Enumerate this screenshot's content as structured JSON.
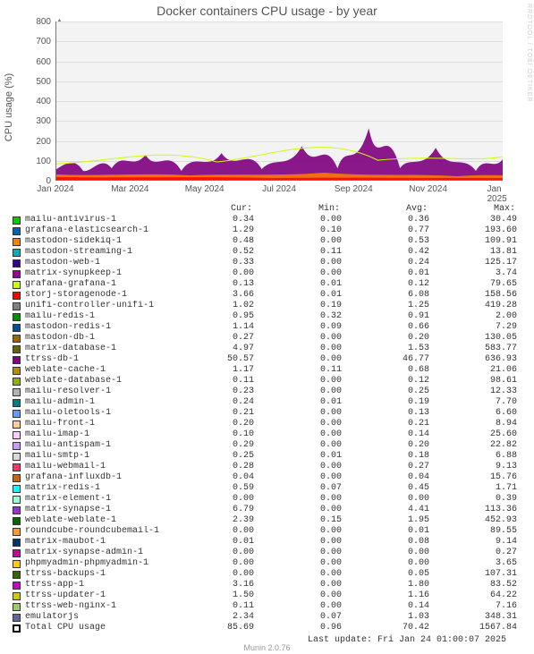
{
  "title": "Docker containers CPU usage - by year",
  "y_axis_label": "CPU usage (%)",
  "watermark": "RRDTOOL / TOBI OETIKER",
  "footer": "Munin 2.0.76",
  "last_update": "Last update: Fri Jan 24 01:00:07 2025",
  "columns": {
    "cur": "Cur:",
    "min": "Min:",
    "avg": "Avg:",
    "max": "Max:"
  },
  "xticks": [
    "Jan 2024",
    "Mar 2024",
    "May 2024",
    "Jul 2024",
    "Sep 2024",
    "Nov 2024",
    "Jan 2025"
  ],
  "yticks": [
    "0",
    "100",
    "200",
    "300",
    "400",
    "500",
    "600",
    "700",
    "800"
  ],
  "chart_baseline_approx": "Stacked area oscillating mostly between ~30 and ~120 with spikes to ~200 around Sep 2024; dominant purple (ttrss-db-1 / matrix / mastodon)",
  "chart_data": {
    "type": "area-stacked",
    "xlabel": "",
    "ylabel": "CPU usage (%)",
    "ylim": [
      0,
      800
    ],
    "x_range": [
      "2024-01",
      "2025-01"
    ],
    "note": "Per-series time points not labeled on chart; values below are legend stats (Cur/Min/Avg/Max). Visual stacked total hovers ~30–120%, occasional spikes ~200% near Sep 2024.",
    "series_stats_ref": "rows"
  },
  "rows": [
    {
      "c": "#00cc00",
      "n": "mailu-antivirus-1",
      "cur": "0.34",
      "min": "0.00",
      "avg": "0.36",
      "max": "30.49"
    },
    {
      "c": "#0066b3",
      "n": "grafana-elasticsearch-1",
      "cur": "1.29",
      "min": "0.10",
      "avg": "0.77",
      "max": "193.60"
    },
    {
      "c": "#ff8000",
      "n": "mastodon-sidekiq-1",
      "cur": "0.48",
      "min": "0.00",
      "avg": "0.53",
      "max": "109.91"
    },
    {
      "c": "#00b3b3",
      "n": "mastodon-streaming-1",
      "cur": "0.52",
      "min": "0.11",
      "avg": "0.42",
      "max": "13.81"
    },
    {
      "c": "#330099",
      "n": "mastodon-web-1",
      "cur": "0.33",
      "min": "0.00",
      "avg": "0.24",
      "max": "125.17"
    },
    {
      "c": "#990099",
      "n": "matrix-synupkeep-1",
      "cur": "0.00",
      "min": "0.00",
      "avg": "0.01",
      "max": "3.74"
    },
    {
      "c": "#ccff00",
      "n": "grafana-grafana-1",
      "cur": "0.13",
      "min": "0.01",
      "avg": "0.12",
      "max": "79.65"
    },
    {
      "c": "#ff0000",
      "n": "storj-storagenode-1",
      "cur": "3.66",
      "min": "0.01",
      "avg": "6.08",
      "max": "158.56"
    },
    {
      "c": "#808080",
      "n": "unifi-controller-unifi-1",
      "cur": "1.02",
      "min": "0.19",
      "avg": "1.25",
      "max": "419.28"
    },
    {
      "c": "#008f00",
      "n": "mailu-redis-1",
      "cur": "0.95",
      "min": "0.32",
      "avg": "0.91",
      "max": "2.00"
    },
    {
      "c": "#004d99",
      "n": "mastodon-redis-1",
      "cur": "1.14",
      "min": "0.09",
      "avg": "0.66",
      "max": "7.29"
    },
    {
      "c": "#996600",
      "n": "mastodon-db-1",
      "cur": "0.27",
      "min": "0.00",
      "avg": "0.20",
      "max": "130.05"
    },
    {
      "c": "#666600",
      "n": "matrix-database-1",
      "cur": "4.97",
      "min": "0.00",
      "avg": "1.53",
      "max": "583.77"
    },
    {
      "c": "#800080",
      "n": "ttrss-db-1",
      "cur": "50.57",
      "min": "0.00",
      "avg": "46.77",
      "max": "636.93"
    },
    {
      "c": "#b38f00",
      "n": "weblate-cache-1",
      "cur": "1.17",
      "min": "0.11",
      "avg": "0.68",
      "max": "21.06"
    },
    {
      "c": "#8fb300",
      "n": "weblate-database-1",
      "cur": "0.11",
      "min": "0.00",
      "avg": "0.12",
      "max": "98.61"
    },
    {
      "c": "#b3b3b3",
      "n": "mailu-resolver-1",
      "cur": "0.23",
      "min": "0.00",
      "avg": "0.25",
      "max": "12.33"
    },
    {
      "c": "#007d7d",
      "n": "mailu-admin-1",
      "cur": "0.24",
      "min": "0.01",
      "avg": "0.19",
      "max": "7.70"
    },
    {
      "c": "#6699ff",
      "n": "mailu-oletools-1",
      "cur": "0.21",
      "min": "0.00",
      "avg": "0.13",
      "max": "6.60"
    },
    {
      "c": "#ffcc99",
      "n": "mailu-front-1",
      "cur": "0.20",
      "min": "0.00",
      "avg": "0.21",
      "max": "8.94"
    },
    {
      "c": "#ffccff",
      "n": "mailu-imap-1",
      "cur": "0.10",
      "min": "0.00",
      "avg": "0.14",
      "max": "25.60"
    },
    {
      "c": "#cc99ff",
      "n": "mailu-antispam-1",
      "cur": "0.29",
      "min": "0.00",
      "avg": "0.20",
      "max": "22.82"
    },
    {
      "c": "#d9d9d9",
      "n": "mailu-smtp-1",
      "cur": "0.25",
      "min": "0.01",
      "avg": "0.18",
      "max": "6.88"
    },
    {
      "c": "#ff3366",
      "n": "mailu-webmail-1",
      "cur": "0.28",
      "min": "0.00",
      "avg": "0.27",
      "max": "9.13"
    },
    {
      "c": "#cc6600",
      "n": "grafana-influxdb-1",
      "cur": "0.04",
      "min": "0.00",
      "avg": "0.04",
      "max": "15.76"
    },
    {
      "c": "#00ffff",
      "n": "matrix-redis-1",
      "cur": "0.59",
      "min": "0.07",
      "avg": "0.45",
      "max": "1.71"
    },
    {
      "c": "#99ffcc",
      "n": "matrix-element-1",
      "cur": "0.00",
      "min": "0.00",
      "avg": "0.00",
      "max": "0.39"
    },
    {
      "c": "#9933cc",
      "n": "matrix-synapse-1",
      "cur": "6.79",
      "min": "0.00",
      "avg": "4.41",
      "max": "113.36"
    },
    {
      "c": "#006600",
      "n": "weblate-weblate-1",
      "cur": "2.39",
      "min": "0.15",
      "avg": "1.95",
      "max": "452.93"
    },
    {
      "c": "#ff9933",
      "n": "roundcube-roundcubemail-1",
      "cur": "0.00",
      "min": "0.00",
      "avg": "0.01",
      "max": "89.55"
    },
    {
      "c": "#003366",
      "n": "matrix-maubot-1",
      "cur": "0.01",
      "min": "0.00",
      "avg": "0.08",
      "max": "9.14"
    },
    {
      "c": "#cc0099",
      "n": "matrix-synapse-admin-1",
      "cur": "0.00",
      "min": "0.00",
      "avg": "0.00",
      "max": "0.27"
    },
    {
      "c": "#ffcc00",
      "n": "phpmyadmin-phpmyadmin-1",
      "cur": "0.00",
      "min": "0.00",
      "avg": "0.00",
      "max": "3.65"
    },
    {
      "c": "#336600",
      "n": "ttrss-backups-1",
      "cur": "0.00",
      "min": "0.00",
      "avg": "0.05",
      "max": "107.31"
    },
    {
      "c": "#cc00cc",
      "n": "ttrss-app-1",
      "cur": "3.16",
      "min": "0.00",
      "avg": "1.80",
      "max": "83.52"
    },
    {
      "c": "#cccc00",
      "n": "ttrss-updater-1",
      "cur": "1.50",
      "min": "0.00",
      "avg": "1.16",
      "max": "64.22"
    },
    {
      "c": "#99cc66",
      "n": "ttrss-web-nginx-1",
      "cur": "0.11",
      "min": "0.00",
      "avg": "0.14",
      "max": "7.16"
    },
    {
      "c": "#666699",
      "n": "emulatorjs",
      "cur": "2.34",
      "min": "0.07",
      "avg": "1.03",
      "max": "348.31"
    },
    {
      "c": "#000000",
      "n": "Total CPU usage",
      "cur": "85.69",
      "min": "0.96",
      "avg": "70.42",
      "max": "1567.84",
      "total": true
    }
  ]
}
